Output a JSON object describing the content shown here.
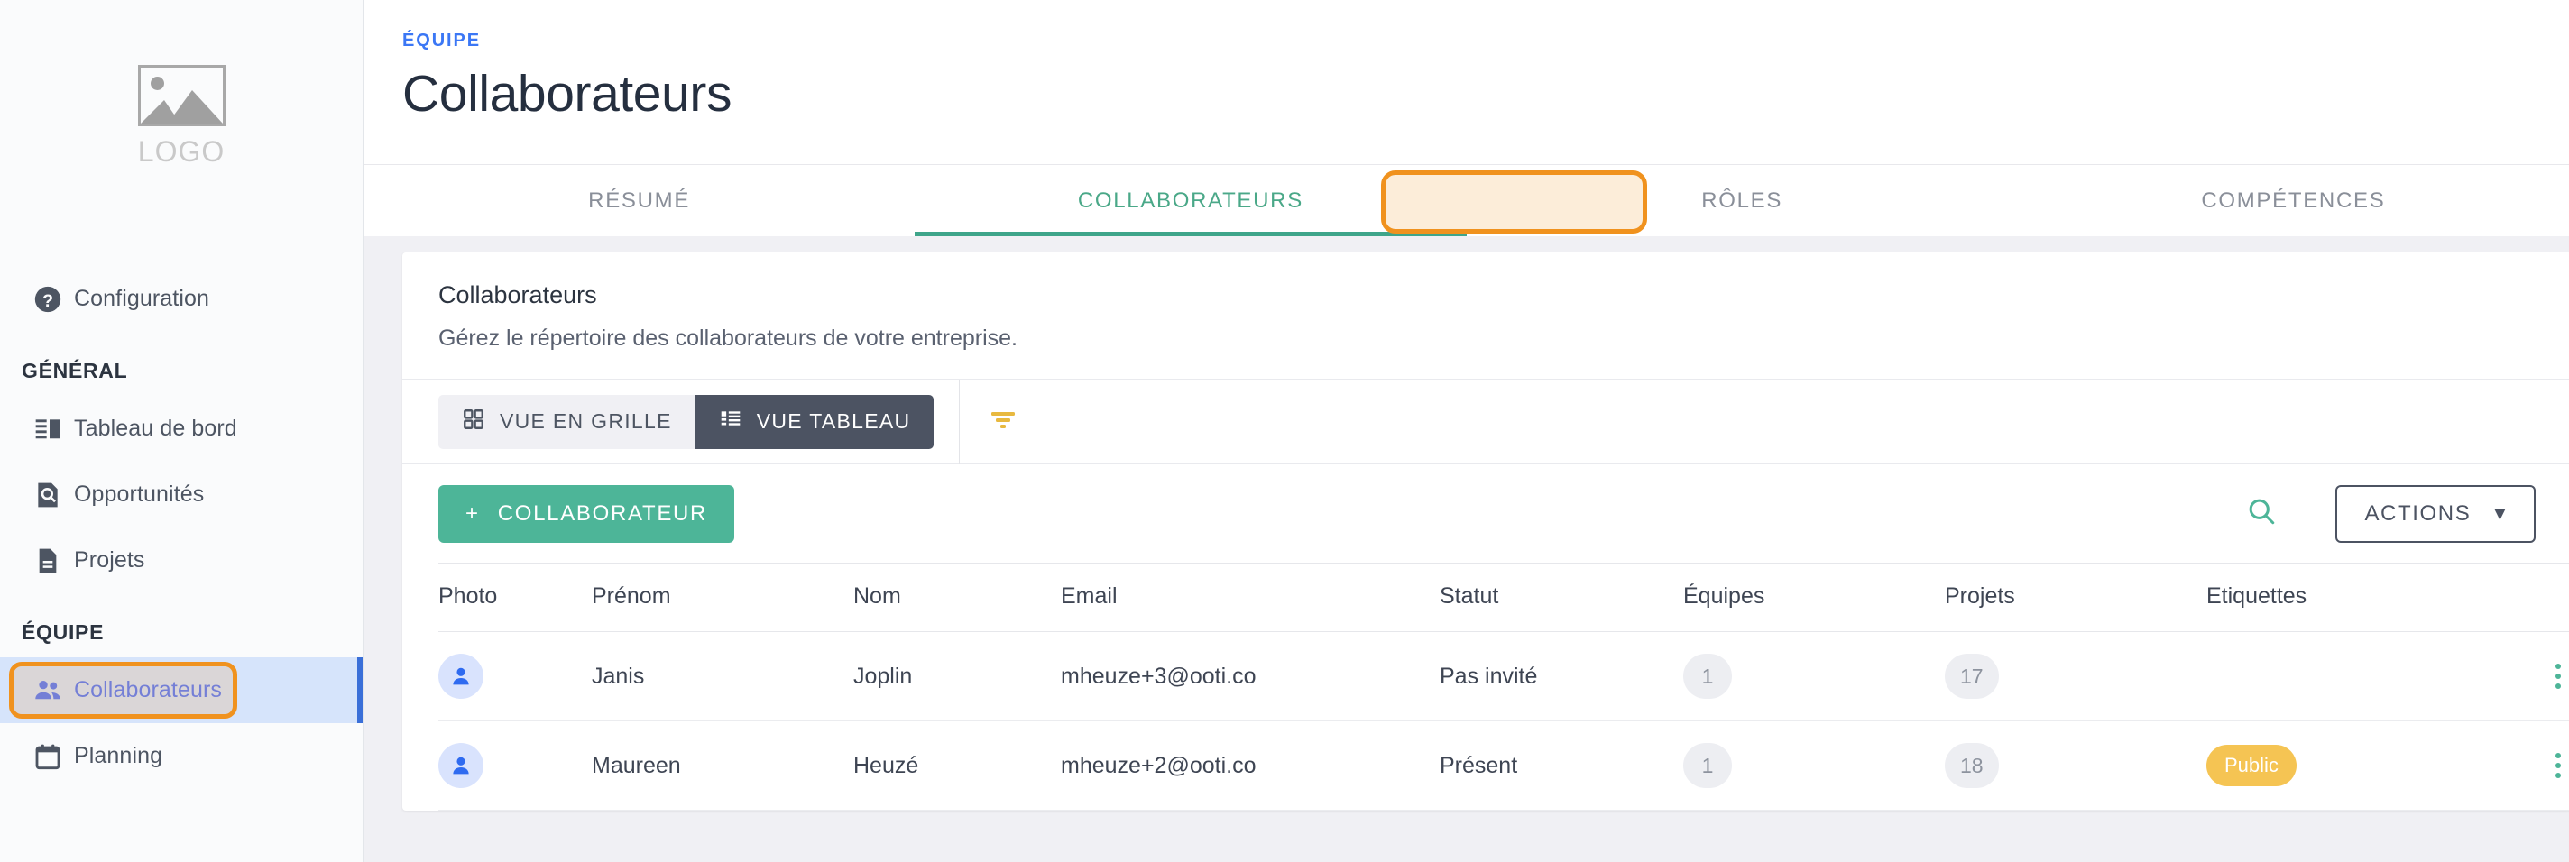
{
  "sidebar": {
    "logo_text": "LOGO",
    "top_item": {
      "label": "Configuration",
      "icon": "help-circle-icon"
    },
    "sections": [
      {
        "title": "GÉNÉRAL",
        "items": [
          {
            "label": "Tableau de bord",
            "icon": "dashboard-icon",
            "active": false
          },
          {
            "label": "Opportunités",
            "icon": "search-document-icon",
            "active": false
          },
          {
            "label": "Projets",
            "icon": "document-icon",
            "active": false
          }
        ]
      },
      {
        "title": "ÉQUIPE",
        "items": [
          {
            "label": "Collaborateurs",
            "icon": "people-icon",
            "active": true
          },
          {
            "label": "Planning",
            "icon": "calendar-icon",
            "active": false
          }
        ]
      }
    ]
  },
  "header": {
    "eyebrow": "ÉQUIPE",
    "title": "Collaborateurs"
  },
  "tabs": [
    {
      "label": "RÉSUMÉ",
      "active": false
    },
    {
      "label": "COLLABORATEURS",
      "active": true
    },
    {
      "label": "RÔLES",
      "active": false
    },
    {
      "label": "COMPÉTENCES",
      "active": false
    }
  ],
  "card": {
    "title": "Collaborateurs",
    "subtitle": "Gérez le répertoire des collaborateurs de votre entreprise."
  },
  "toolbar": {
    "grid_view_label": "VUE EN GRILLE",
    "table_view_label": "VUE TABLEAU",
    "filter_icon": "filter-icon"
  },
  "actions": {
    "add_label": "COLLABORATEUR",
    "add_plus": "+",
    "search_icon": "search-icon",
    "actions_label": "ACTIONS",
    "caret": "▾"
  },
  "table": {
    "columns": [
      "Photo",
      "Prénom",
      "Nom",
      "Email",
      "Statut",
      "Équipes",
      "Projets",
      "Etiquettes"
    ],
    "rows": [
      {
        "photo": "avatar-icon",
        "prenom": "Janis",
        "nom": "Joplin",
        "email": "mheuze+3@ooti.co",
        "statut": "Pas invité",
        "equipes": "1",
        "projets": "17",
        "etiquettes": ""
      },
      {
        "photo": "avatar-icon",
        "prenom": "Maureen",
        "nom": "Heuzé",
        "email": "mheuze+2@ooti.co",
        "statut": "Présent",
        "equipes": "1",
        "projets": "18",
        "etiquettes": "Public"
      }
    ]
  },
  "colors": {
    "accent_green": "#4db598",
    "annotation_orange": "#f0921e",
    "active_nav_blue": "#5c7cfa",
    "tag_yellow": "#f5c453",
    "eyebrow_blue": "#3b77f5"
  }
}
